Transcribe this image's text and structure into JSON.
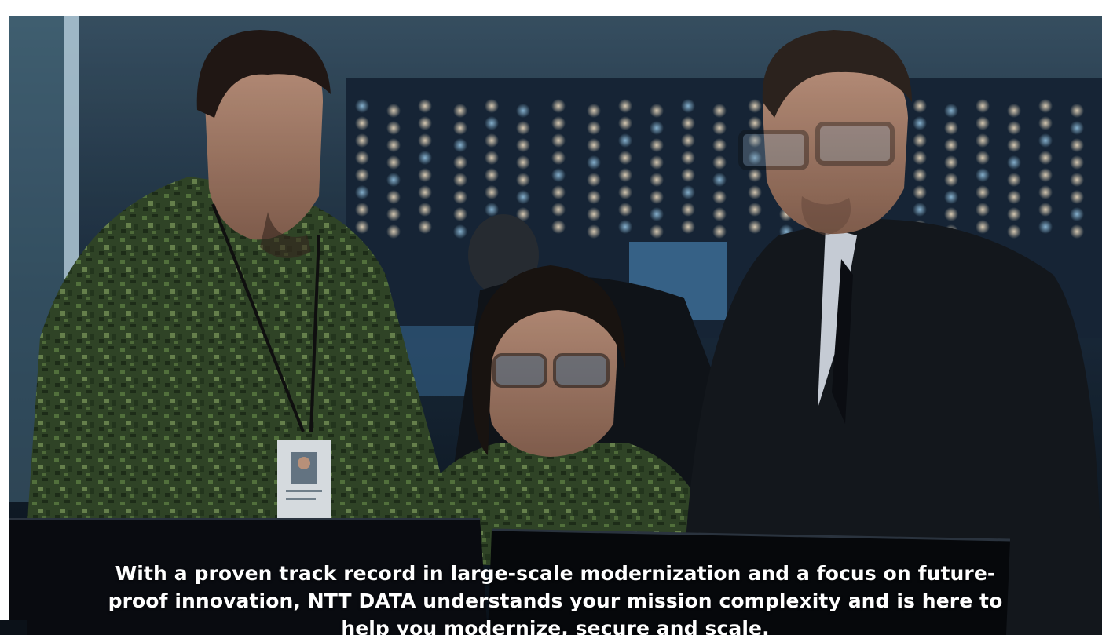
{
  "hero": {
    "image_description_icon": "photo-operations-center",
    "caption": "With a proven track record in large-scale modernization and a focus on future-proof innovation, NTT DATA understands your mission complexity and is here to help you modernize, secure and scale."
  },
  "colors": {
    "background": "#ffffff",
    "caption_text": "#ffffff",
    "scene_dark": "#0c1722",
    "camo_green": "#3d5a2e",
    "suit_dark": "#161a20",
    "screen_glow": "#6fa9d8"
  }
}
